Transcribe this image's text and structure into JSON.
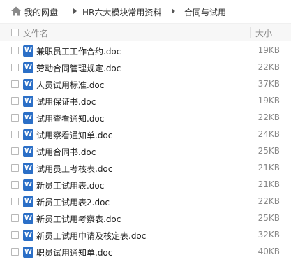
{
  "breadcrumb": {
    "items": [
      "我的网盘",
      "HR六大模块常用资料",
      "合同与试用"
    ]
  },
  "header": {
    "name_label": "文件名",
    "size_label": "大小"
  },
  "files": [
    {
      "name": "兼职员工工作合约.doc",
      "size": "19KB"
    },
    {
      "name": "劳动合同管理规定.doc",
      "size": "22KB"
    },
    {
      "name": "人员试用标准.doc",
      "size": "37KB"
    },
    {
      "name": "试用保证书.doc",
      "size": "19KB"
    },
    {
      "name": "试用查看通知.doc",
      "size": "22KB"
    },
    {
      "name": "试用察看通知单.doc",
      "size": "24KB"
    },
    {
      "name": "试用合同书.doc",
      "size": "25KB"
    },
    {
      "name": "试用员工考核表.doc",
      "size": "21KB"
    },
    {
      "name": "新员工试用表.doc",
      "size": "21KB"
    },
    {
      "name": "新员工试用表2.doc",
      "size": "22KB"
    },
    {
      "name": "新员工试用考察表.doc",
      "size": "25KB"
    },
    {
      "name": "新员工试用申请及核定表.doc",
      "size": "32KB"
    },
    {
      "name": "职员试用通知单.doc",
      "size": "40KB"
    }
  ],
  "file_type_letter": "W",
  "colors": {
    "word_icon": "#2b6fc7",
    "header_bg": "#f7f7f7",
    "home_icon": "#8a8a8a"
  },
  "icons": {
    "home": "home-icon",
    "separator": "triangle-right-icon",
    "file": "word-doc-icon"
  }
}
